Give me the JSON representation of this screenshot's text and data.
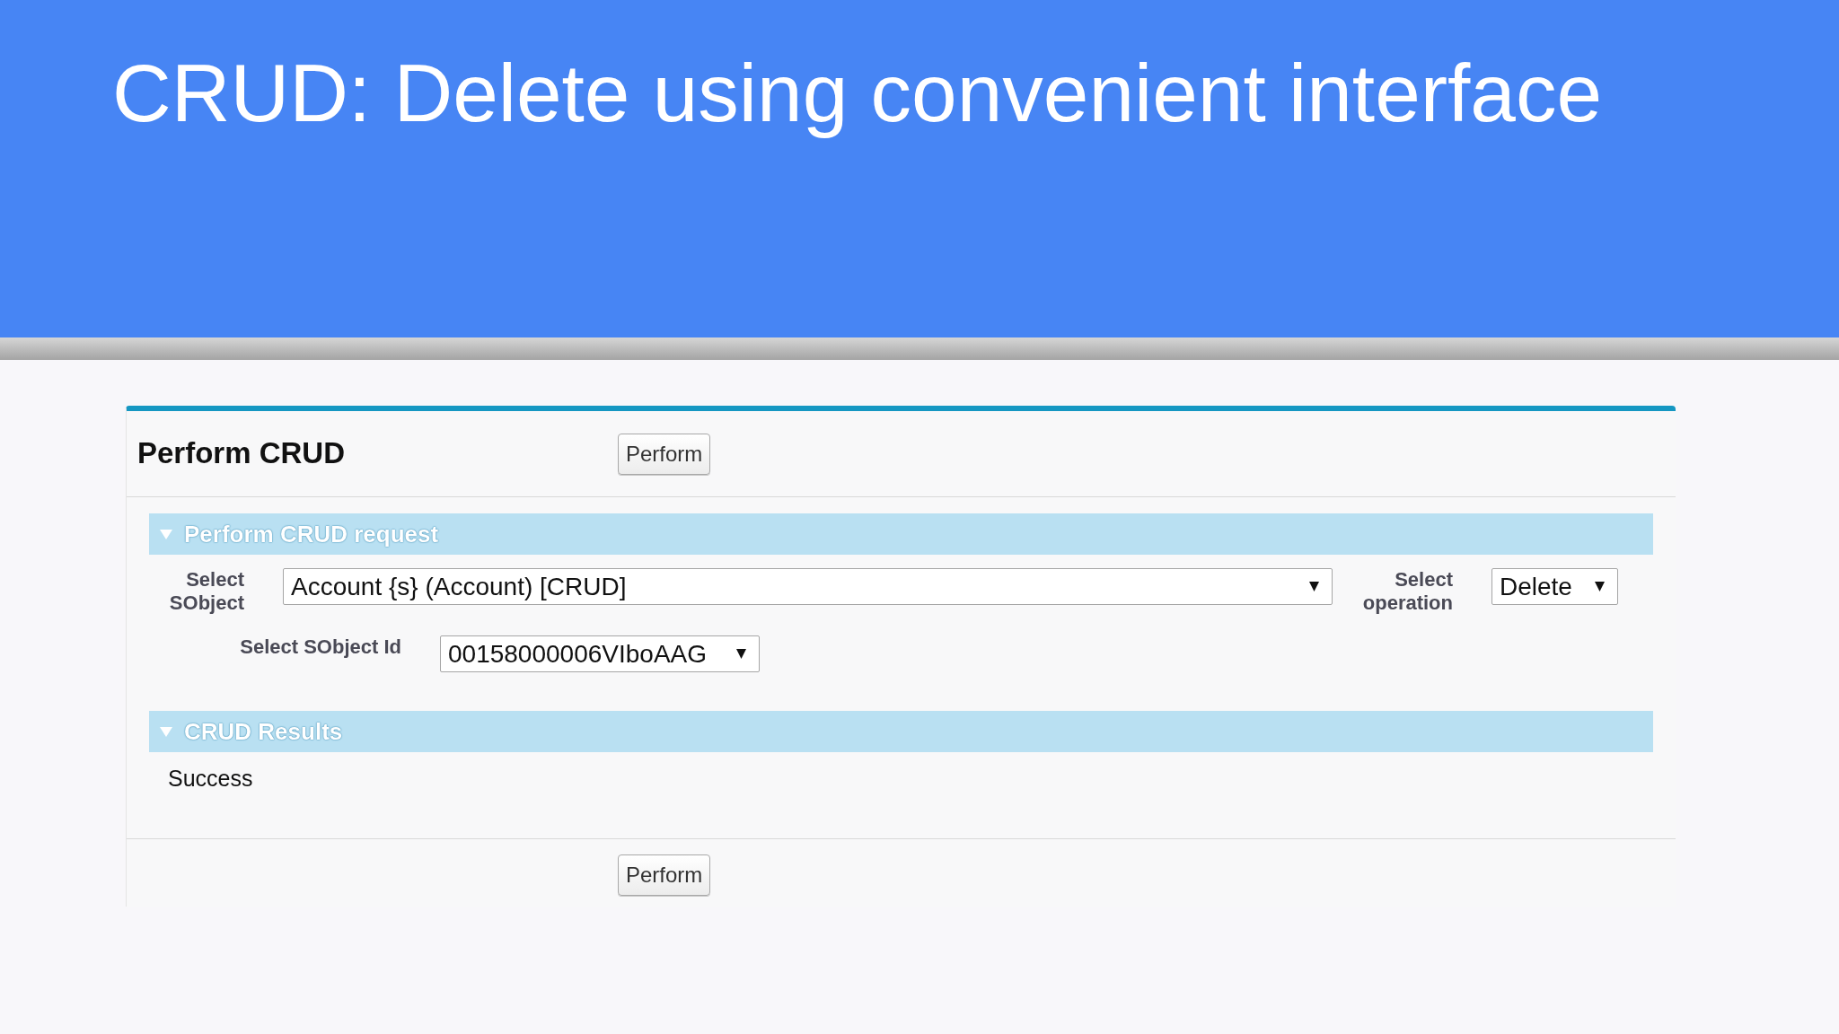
{
  "slide": {
    "title": "CRUD: Delete using convenient interface"
  },
  "page_block": {
    "title": "Perform CRUD",
    "top_buttons": [
      "Perform"
    ],
    "sections": [
      {
        "kind": "form",
        "title": "Perform CRUD request",
        "expanded": true,
        "rows": [
          {
            "fields": [
              {
                "label": "Select SObject",
                "value": "Account {s} (Account) [CRUD]"
              },
              {
                "label": "Select operation",
                "value": "Delete"
              }
            ]
          },
          {
            "fields": [
              {
                "label": "Select SObject Id",
                "value": "00158000006VIboAAG"
              }
            ]
          }
        ]
      },
      {
        "kind": "message",
        "title": "CRUD Results",
        "expanded": true,
        "text": "Success"
      }
    ],
    "bottom_buttons": [
      "Perform"
    ]
  }
}
